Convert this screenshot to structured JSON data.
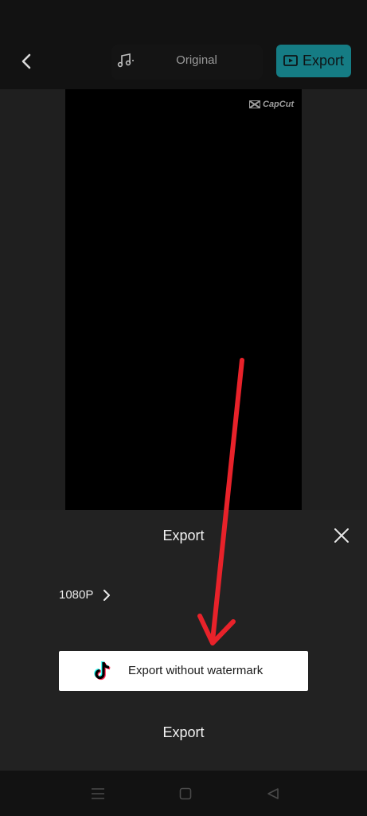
{
  "topbar": {
    "mode_label": "Original",
    "export_label": "Export"
  },
  "preview": {
    "watermark_text": "CapCut"
  },
  "sheet": {
    "title": "Export",
    "resolution": "1080P",
    "export_without_watermark": "Export without watermark",
    "export_label": "Export"
  },
  "colors": {
    "accent": "#157c84",
    "arrow": "#e8222a",
    "sheet_bg": "#222222",
    "screen_bg": "#121212"
  },
  "icons": [
    "back-chevron-icon",
    "music-note-icon",
    "export-video-icon",
    "capcut-logo-icon",
    "close-icon",
    "chevron-right-icon",
    "tiktok-icon",
    "menu-icon",
    "home-square-icon",
    "back-triangle-icon"
  ]
}
